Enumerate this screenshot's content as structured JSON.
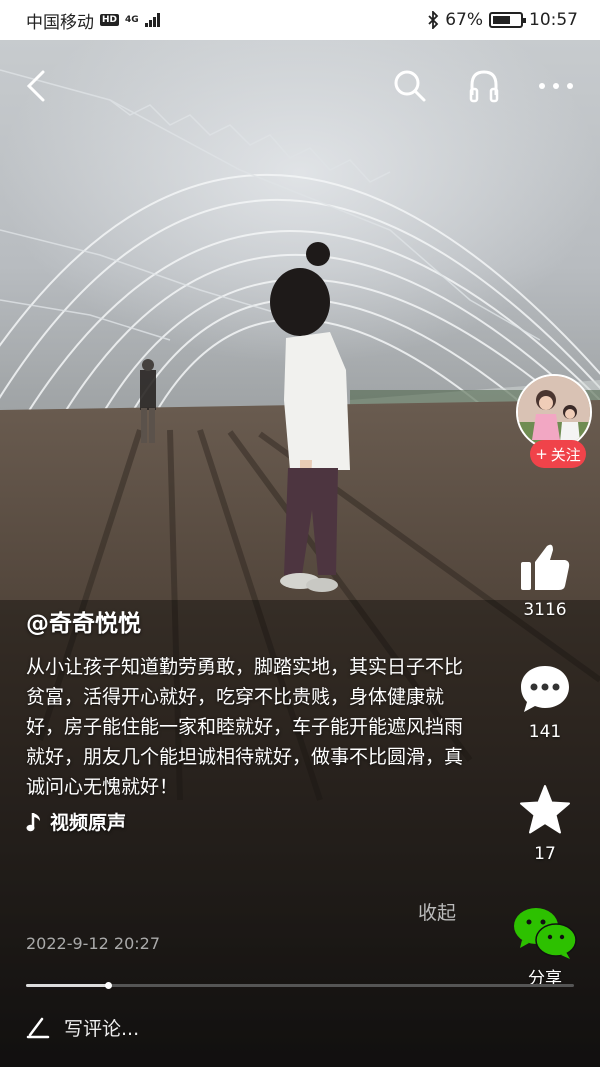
{
  "status_bar": {
    "carrier": "中国移动",
    "hd": "HD",
    "network": "4G",
    "battery_percent": "67%",
    "battery_level": 0.67,
    "time": "10:57"
  },
  "author": "@奇奇悦悦",
  "description": "从小让孩子知道勤劳勇敢，脚踏实地，其实日子不比贫富，活得开心就好，吃穿不比贵贱，身体健康就好，房子能住能一家和睦就好，车子能开能遮风挡雨就好，朋友几个能坦诚相待就好，做事不比圆滑，真诚问心无愧就好！",
  "music": "视频原声",
  "collapse_label": "收起",
  "date": "2022-9-12 20:27",
  "follow_label": "关注",
  "likes": "3116",
  "comments": "141",
  "favorites": "17",
  "share_label": "分享",
  "comment_placeholder": "写评论...",
  "progress_fraction": 0.15,
  "colors": {
    "follow": "#f0434a",
    "wechat": "#2dc100"
  },
  "icons": [
    "back-icon",
    "search-icon",
    "headphones-icon",
    "more-icon",
    "thumbs-up-icon",
    "comment-icon",
    "star-icon",
    "wechat-icon",
    "music-note-icon",
    "pen-icon"
  ]
}
